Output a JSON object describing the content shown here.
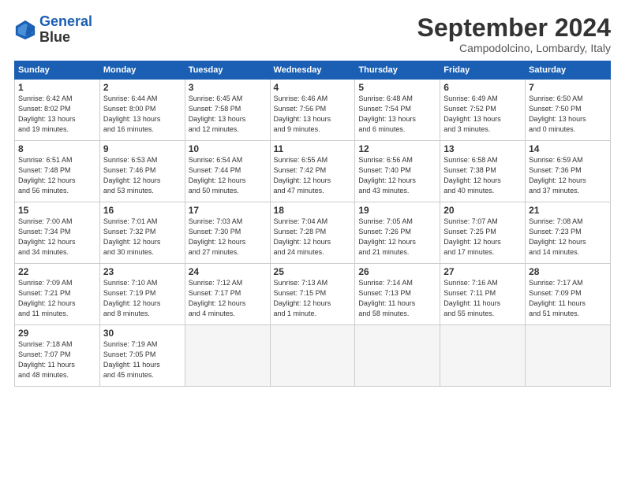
{
  "logo": {
    "line1": "General",
    "line2": "Blue"
  },
  "title": "September 2024",
  "location": "Campodolcino, Lombardy, Italy",
  "days_of_week": [
    "Sunday",
    "Monday",
    "Tuesday",
    "Wednesday",
    "Thursday",
    "Friday",
    "Saturday"
  ],
  "weeks": [
    [
      {
        "num": "1",
        "info": "Sunrise: 6:42 AM\nSunset: 8:02 PM\nDaylight: 13 hours\nand 19 minutes."
      },
      {
        "num": "2",
        "info": "Sunrise: 6:44 AM\nSunset: 8:00 PM\nDaylight: 13 hours\nand 16 minutes."
      },
      {
        "num": "3",
        "info": "Sunrise: 6:45 AM\nSunset: 7:58 PM\nDaylight: 13 hours\nand 12 minutes."
      },
      {
        "num": "4",
        "info": "Sunrise: 6:46 AM\nSunset: 7:56 PM\nDaylight: 13 hours\nand 9 minutes."
      },
      {
        "num": "5",
        "info": "Sunrise: 6:48 AM\nSunset: 7:54 PM\nDaylight: 13 hours\nand 6 minutes."
      },
      {
        "num": "6",
        "info": "Sunrise: 6:49 AM\nSunset: 7:52 PM\nDaylight: 13 hours\nand 3 minutes."
      },
      {
        "num": "7",
        "info": "Sunrise: 6:50 AM\nSunset: 7:50 PM\nDaylight: 13 hours\nand 0 minutes."
      }
    ],
    [
      {
        "num": "8",
        "info": "Sunrise: 6:51 AM\nSunset: 7:48 PM\nDaylight: 12 hours\nand 56 minutes."
      },
      {
        "num": "9",
        "info": "Sunrise: 6:53 AM\nSunset: 7:46 PM\nDaylight: 12 hours\nand 53 minutes."
      },
      {
        "num": "10",
        "info": "Sunrise: 6:54 AM\nSunset: 7:44 PM\nDaylight: 12 hours\nand 50 minutes."
      },
      {
        "num": "11",
        "info": "Sunrise: 6:55 AM\nSunset: 7:42 PM\nDaylight: 12 hours\nand 47 minutes."
      },
      {
        "num": "12",
        "info": "Sunrise: 6:56 AM\nSunset: 7:40 PM\nDaylight: 12 hours\nand 43 minutes."
      },
      {
        "num": "13",
        "info": "Sunrise: 6:58 AM\nSunset: 7:38 PM\nDaylight: 12 hours\nand 40 minutes."
      },
      {
        "num": "14",
        "info": "Sunrise: 6:59 AM\nSunset: 7:36 PM\nDaylight: 12 hours\nand 37 minutes."
      }
    ],
    [
      {
        "num": "15",
        "info": "Sunrise: 7:00 AM\nSunset: 7:34 PM\nDaylight: 12 hours\nand 34 minutes."
      },
      {
        "num": "16",
        "info": "Sunrise: 7:01 AM\nSunset: 7:32 PM\nDaylight: 12 hours\nand 30 minutes."
      },
      {
        "num": "17",
        "info": "Sunrise: 7:03 AM\nSunset: 7:30 PM\nDaylight: 12 hours\nand 27 minutes."
      },
      {
        "num": "18",
        "info": "Sunrise: 7:04 AM\nSunset: 7:28 PM\nDaylight: 12 hours\nand 24 minutes."
      },
      {
        "num": "19",
        "info": "Sunrise: 7:05 AM\nSunset: 7:26 PM\nDaylight: 12 hours\nand 21 minutes."
      },
      {
        "num": "20",
        "info": "Sunrise: 7:07 AM\nSunset: 7:25 PM\nDaylight: 12 hours\nand 17 minutes."
      },
      {
        "num": "21",
        "info": "Sunrise: 7:08 AM\nSunset: 7:23 PM\nDaylight: 12 hours\nand 14 minutes."
      }
    ],
    [
      {
        "num": "22",
        "info": "Sunrise: 7:09 AM\nSunset: 7:21 PM\nDaylight: 12 hours\nand 11 minutes."
      },
      {
        "num": "23",
        "info": "Sunrise: 7:10 AM\nSunset: 7:19 PM\nDaylight: 12 hours\nand 8 minutes."
      },
      {
        "num": "24",
        "info": "Sunrise: 7:12 AM\nSunset: 7:17 PM\nDaylight: 12 hours\nand 4 minutes."
      },
      {
        "num": "25",
        "info": "Sunrise: 7:13 AM\nSunset: 7:15 PM\nDaylight: 12 hours\nand 1 minute."
      },
      {
        "num": "26",
        "info": "Sunrise: 7:14 AM\nSunset: 7:13 PM\nDaylight: 11 hours\nand 58 minutes."
      },
      {
        "num": "27",
        "info": "Sunrise: 7:16 AM\nSunset: 7:11 PM\nDaylight: 11 hours\nand 55 minutes."
      },
      {
        "num": "28",
        "info": "Sunrise: 7:17 AM\nSunset: 7:09 PM\nDaylight: 11 hours\nand 51 minutes."
      }
    ],
    [
      {
        "num": "29",
        "info": "Sunrise: 7:18 AM\nSunset: 7:07 PM\nDaylight: 11 hours\nand 48 minutes."
      },
      {
        "num": "30",
        "info": "Sunrise: 7:19 AM\nSunset: 7:05 PM\nDaylight: 11 hours\nand 45 minutes."
      },
      {
        "num": "",
        "info": ""
      },
      {
        "num": "",
        "info": ""
      },
      {
        "num": "",
        "info": ""
      },
      {
        "num": "",
        "info": ""
      },
      {
        "num": "",
        "info": ""
      }
    ]
  ]
}
